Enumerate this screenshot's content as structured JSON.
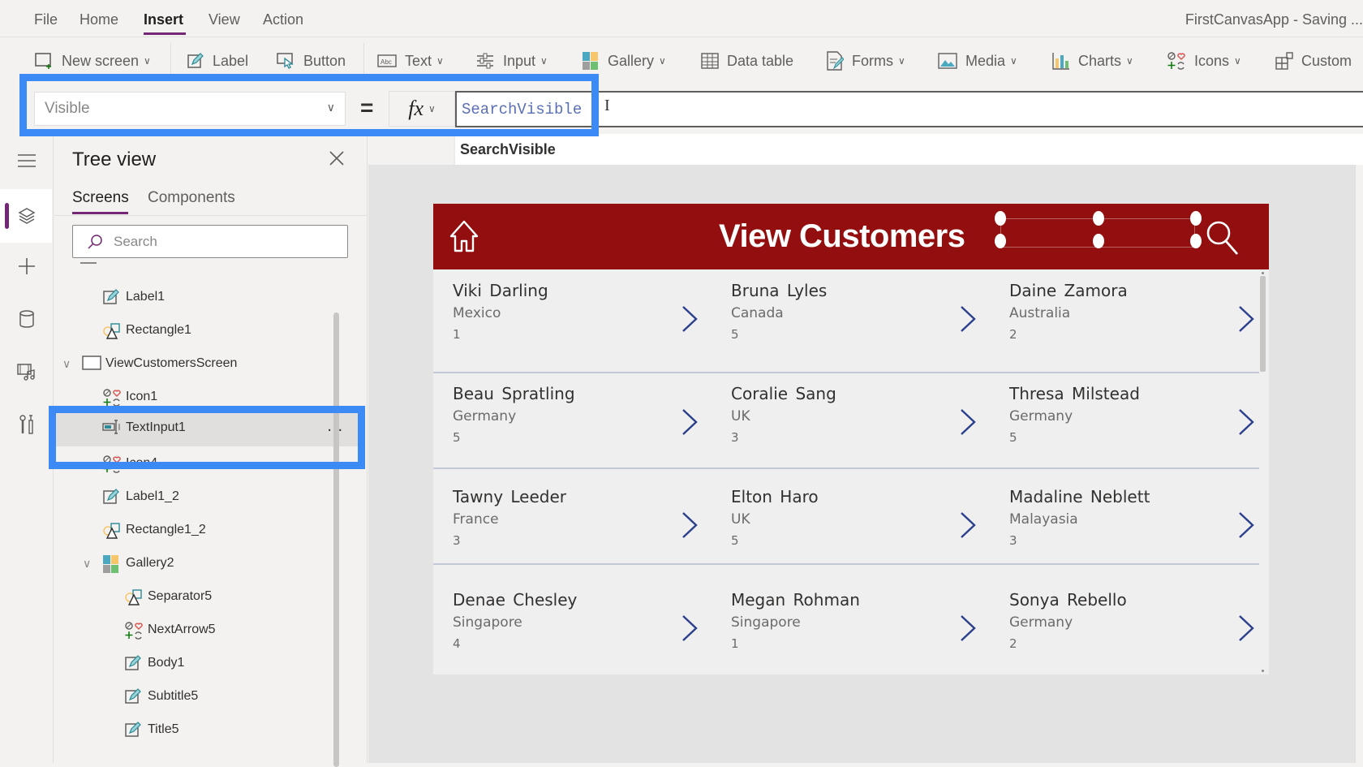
{
  "menu": {
    "items": [
      {
        "label": "File",
        "active": false
      },
      {
        "label": "Home",
        "active": false
      },
      {
        "label": "Insert",
        "active": true
      },
      {
        "label": "View",
        "active": false
      },
      {
        "label": "Action",
        "active": false
      }
    ],
    "app_title": "FirstCanvasApp - Saving ..."
  },
  "ribbon": {
    "new_screen": "New screen",
    "label": "Label",
    "button": "Button",
    "text": "Text",
    "input": "Input",
    "gallery": "Gallery",
    "data_table": "Data table",
    "forms": "Forms",
    "media": "Media",
    "charts": "Charts",
    "icons": "Icons",
    "custom": "Custom"
  },
  "formula_bar": {
    "property": "Visible",
    "equals": "=",
    "fx": "fx",
    "formula": "SearchVisible",
    "suggestion": "SearchVisible"
  },
  "tree_view": {
    "title": "Tree view",
    "tabs": [
      "Screens",
      "Components"
    ],
    "active_tab": "Screens",
    "search_placeholder": "Search",
    "items": [
      {
        "label": "Label1",
        "icon": "label-icon",
        "indent": 1
      },
      {
        "label": "Rectangle1",
        "icon": "shape-icon",
        "indent": 1
      },
      {
        "label": "ViewCustomersScreen",
        "icon": "screen-icon",
        "indent": 0,
        "expanded": true
      },
      {
        "label": "Icon1",
        "icon": "icons-icon",
        "indent": 1
      },
      {
        "label": "TextInput1",
        "icon": "text-input-icon",
        "indent": 1,
        "selected": true
      },
      {
        "label": "Icon4",
        "icon": "icons-icon",
        "indent": 1
      },
      {
        "label": "Label1_2",
        "icon": "label-icon",
        "indent": 1
      },
      {
        "label": "Rectangle1_2",
        "icon": "shape-icon",
        "indent": 1
      },
      {
        "label": "Gallery2",
        "icon": "gallery-icon",
        "indent": 1,
        "expanded": true
      },
      {
        "label": "Separator5",
        "icon": "shape-icon",
        "indent": 2
      },
      {
        "label": "NextArrow5",
        "icon": "icons-icon",
        "indent": 2
      },
      {
        "label": "Body1",
        "icon": "label-icon",
        "indent": 2
      },
      {
        "label": "Subtitle5",
        "icon": "label-icon",
        "indent": 2
      },
      {
        "label": "Title5",
        "icon": "label-icon",
        "indent": 2
      }
    ],
    "more_label": "..."
  },
  "app": {
    "title": "View Customers",
    "header_color": "#930e0e",
    "customers": [
      {
        "name": "Viki Darling",
        "country": "Mexico",
        "value": "1"
      },
      {
        "name": "Bruna Lyles",
        "country": "Canada",
        "value": "5"
      },
      {
        "name": "Daine Zamora",
        "country": "Australia",
        "value": "2"
      },
      {
        "name": "Beau Spratling",
        "country": "Germany",
        "value": "5"
      },
      {
        "name": "Coralie Sang",
        "country": "UK",
        "value": "3"
      },
      {
        "name": "Thresa Milstead",
        "country": "Germany",
        "value": "5"
      },
      {
        "name": "Tawny Leeder",
        "country": "France",
        "value": "3"
      },
      {
        "name": "Elton Haro",
        "country": "UK",
        "value": "5"
      },
      {
        "name": "Madaline Neblett",
        "country": "Malayasia",
        "value": "3"
      },
      {
        "name": "Denae Chesley",
        "country": "Singapore",
        "value": "4"
      },
      {
        "name": "Megan Rohman",
        "country": "Singapore",
        "value": "1"
      },
      {
        "name": "Sonya Rebello",
        "country": "Germany",
        "value": "2"
      }
    ]
  },
  "colors": {
    "accent": "#742774",
    "highlight": "#3c8af5",
    "arrow": "#2b3f8c"
  }
}
